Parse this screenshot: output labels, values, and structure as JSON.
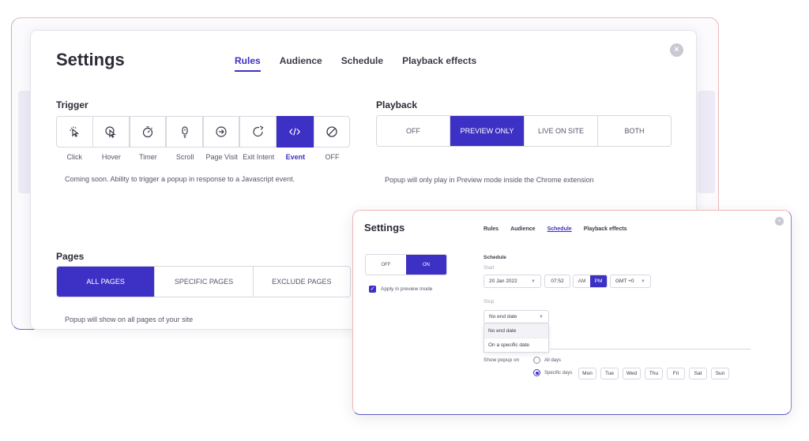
{
  "main": {
    "title": "Settings",
    "tabs": [
      {
        "label": "Rules",
        "active": true
      },
      {
        "label": "Audience",
        "active": false
      },
      {
        "label": "Schedule",
        "active": false
      },
      {
        "label": "Playback effects",
        "active": false
      }
    ],
    "trigger": {
      "label": "Trigger",
      "items": [
        {
          "label": "Click",
          "icon": "cursor-click-icon"
        },
        {
          "label": "Hover",
          "icon": "cursor-hover-icon"
        },
        {
          "label": "Timer",
          "icon": "timer-icon"
        },
        {
          "label": "Scroll",
          "icon": "scroll-mouse-icon"
        },
        {
          "label": "Page Visit",
          "icon": "arrow-right-circle-icon"
        },
        {
          "label": "Exit Intent",
          "icon": "exit-intent-icon"
        },
        {
          "label": "Event",
          "icon": "code-icon",
          "active": true
        },
        {
          "label": "OFF",
          "icon": "off-icon"
        }
      ],
      "description": "Coming soon. Ability to trigger a popup in response to a Javascript event."
    },
    "playback": {
      "label": "Playback",
      "options": [
        "OFF",
        "PREVIEW ONLY",
        "LIVE ON SITE",
        "BOTH"
      ],
      "active": "PREVIEW ONLY",
      "description": "Popup will only play in Preview mode inside the Chrome extension"
    },
    "pages": {
      "label": "Pages",
      "options": [
        "ALL PAGES",
        "SPECIFIC PAGES",
        "EXCLUDE PAGES"
      ],
      "active": "ALL PAGES",
      "description": "Popup will show on all pages of your site"
    }
  },
  "overlay": {
    "title": "Settings",
    "tabs": [
      {
        "label": "Rules",
        "active": false
      },
      {
        "label": "Audience",
        "active": false
      },
      {
        "label": "Schedule",
        "active": true
      },
      {
        "label": "Playback effects",
        "active": false
      }
    ],
    "toggle": {
      "off": "OFF",
      "on": "ON",
      "active": "ON"
    },
    "apply_preview": "Apply in preview mode",
    "schedule_label": "Schedule",
    "start_label": "Start",
    "start_date": "20 Jan 2022",
    "start_time": "07:52",
    "am": "AM",
    "pm": "PM",
    "ampm_active": "PM",
    "timezone": "GMT +0",
    "stop_label": "Stop",
    "stop_value": "No end date",
    "stop_options": [
      "No end date",
      "On a specific date"
    ],
    "show_popup_on": "Show popup on",
    "all_days": "All days",
    "specific_days": "Specific days",
    "days": [
      "Mon",
      "Tue",
      "Wed",
      "Thu",
      "Fri",
      "Sat",
      "Sun"
    ]
  },
  "colors": {
    "accent": "#3d30c4",
    "border": "#d7d7e0"
  }
}
